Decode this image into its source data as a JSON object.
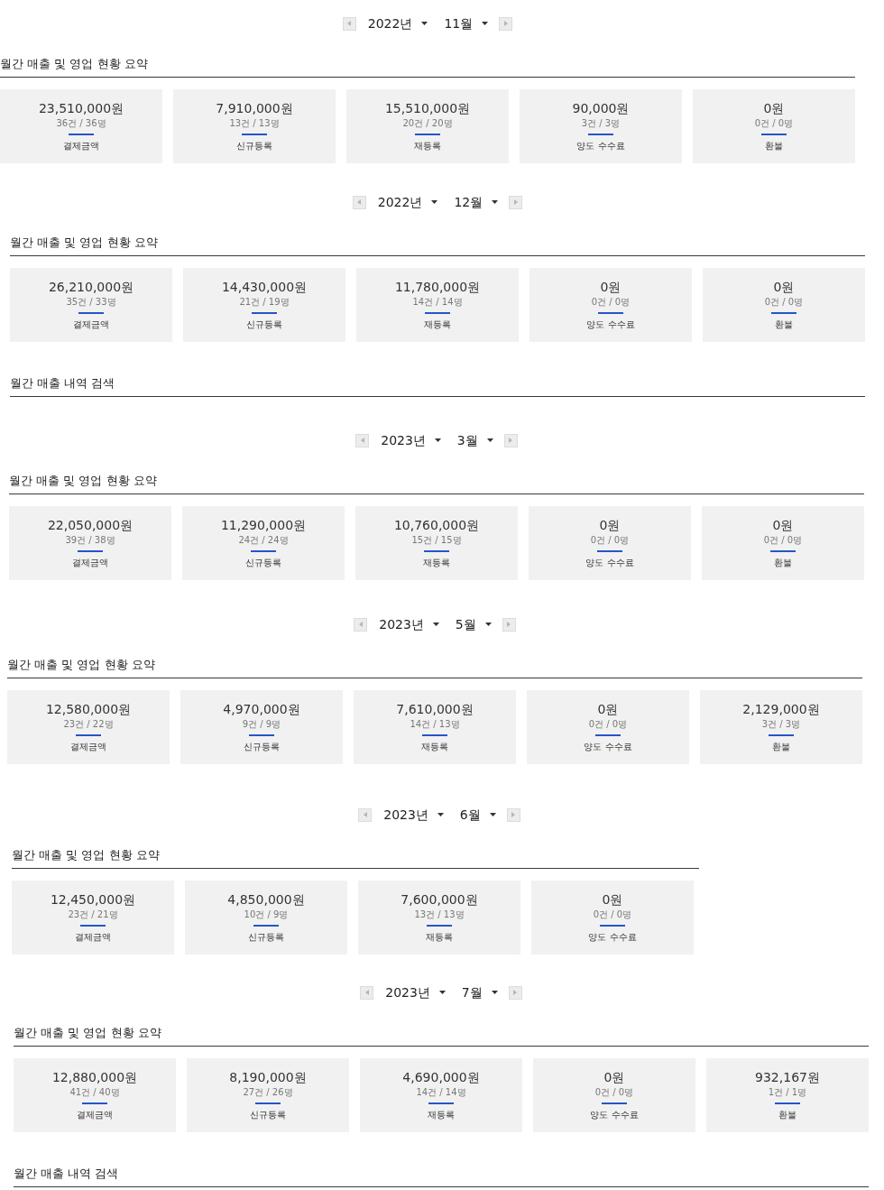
{
  "months": [
    {
      "year": "2022년",
      "month": "11월",
      "summary": {
        "title": "월간 매출 및 영업 현황 요약",
        "cards": [
          {
            "amount": "23,510,000원",
            "count": "36건 / 36명",
            "label": "결제금액"
          },
          {
            "amount": "7,910,000원",
            "count": "13건 / 13명",
            "label": "신규등록"
          },
          {
            "amount": "15,510,000원",
            "count": "20건 / 20명",
            "label": "재등록"
          },
          {
            "amount": "90,000원",
            "count": "3건 / 3명",
            "label": "양도 수수료"
          },
          {
            "amount": "0원",
            "count": "0건 / 0명",
            "label": "환불"
          }
        ]
      }
    },
    {
      "year": "2022년",
      "month": "12월",
      "summary": {
        "title": "월간 매출 및 영업 현황 요약",
        "cards": [
          {
            "amount": "26,210,000원",
            "count": "35건 / 33명",
            "label": "결제금액"
          },
          {
            "amount": "14,430,000원",
            "count": "21건 / 19명",
            "label": "신규등록"
          },
          {
            "amount": "11,780,000원",
            "count": "14건 / 14명",
            "label": "재등록"
          },
          {
            "amount": "0원",
            "count": "0건 / 0명",
            "label": "양도 수수료"
          },
          {
            "amount": "0원",
            "count": "0건 / 0명",
            "label": "환불"
          }
        ]
      },
      "search": {
        "title": "월간 매출 내역 검색"
      }
    },
    {
      "year": "2023년",
      "month": "3월",
      "summary": {
        "title": "월간 매출 및 영업 현황 요약",
        "cards": [
          {
            "amount": "22,050,000원",
            "count": "39건 / 38명",
            "label": "결제금액"
          },
          {
            "amount": "11,290,000원",
            "count": "24건 / 24명",
            "label": "신규등록"
          },
          {
            "amount": "10,760,000원",
            "count": "15건 / 15명",
            "label": "재등록"
          },
          {
            "amount": "0원",
            "count": "0건 / 0명",
            "label": "양도 수수료"
          },
          {
            "amount": "0원",
            "count": "0건 / 0명",
            "label": "환불"
          }
        ]
      }
    },
    {
      "year": "2023년",
      "month": "5월",
      "summary": {
        "title": "월간 매출 및 영업 현황 요약",
        "cards": [
          {
            "amount": "12,580,000원",
            "count": "23건 / 22명",
            "label": "결제금액"
          },
          {
            "amount": "4,970,000원",
            "count": "9건 / 9명",
            "label": "신규등록"
          },
          {
            "amount": "7,610,000원",
            "count": "14건 / 13명",
            "label": "재등록"
          },
          {
            "amount": "0원",
            "count": "0건 / 0명",
            "label": "양도 수수료"
          },
          {
            "amount": "2,129,000원",
            "count": "3건 / 3명",
            "label": "환불"
          }
        ]
      }
    },
    {
      "year": "2023년",
      "month": "6월",
      "summary": {
        "title": "월간 매출 및 영업 현황 요약",
        "cards": [
          {
            "amount": "12,450,000원",
            "count": "23건 / 21명",
            "label": "결제금액"
          },
          {
            "amount": "4,850,000원",
            "count": "10건 / 9명",
            "label": "신규등록"
          },
          {
            "amount": "7,600,000원",
            "count": "13건 / 13명",
            "label": "재등록"
          },
          {
            "amount": "0원",
            "count": "0건 / 0명",
            "label": "양도 수수료"
          }
        ]
      }
    },
    {
      "year": "2023년",
      "month": "7월",
      "summary": {
        "title": "월간 매출 및 영업 현황 요약",
        "cards": [
          {
            "amount": "12,880,000원",
            "count": "41건 / 40명",
            "label": "결제금액"
          },
          {
            "amount": "8,190,000원",
            "count": "27건 / 26명",
            "label": "신규등록"
          },
          {
            "amount": "4,690,000원",
            "count": "14건 / 14명",
            "label": "재등록"
          },
          {
            "amount": "0원",
            "count": "0건 / 0명",
            "label": "양도 수수료"
          },
          {
            "amount": "932,167원",
            "count": "1건 / 1명",
            "label": "환불"
          }
        ]
      },
      "search": {
        "title": "월간 매출 내역 검색"
      }
    }
  ]
}
